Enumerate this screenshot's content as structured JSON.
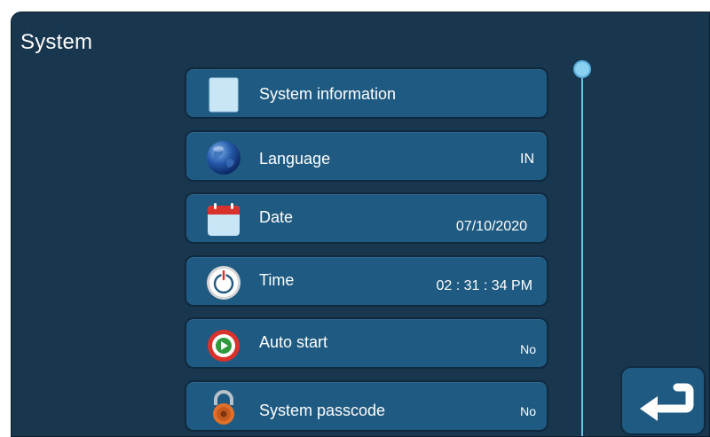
{
  "header": {
    "title": "System"
  },
  "menu": {
    "items": [
      {
        "label": "System information",
        "value": ""
      },
      {
        "label": "Language",
        "value": "IN"
      },
      {
        "label": "Date",
        "value": "07/10/2020"
      },
      {
        "label": "Time",
        "value": "02 : 31 : 34 PM"
      },
      {
        "label": "Auto start",
        "value": "No"
      },
      {
        "label": "System passcode",
        "value": "No"
      }
    ]
  },
  "icons": {
    "system_information": "document-icon",
    "language": "globe-icon",
    "date": "calendar-icon",
    "time": "power-clock-icon",
    "auto_start": "play-icon",
    "system_passcode": "padlock-icon",
    "back": "return-arrow-icon"
  },
  "colors": {
    "background": "#19364f",
    "item": "#1f5a82",
    "scroll": "#8ad0f0"
  }
}
